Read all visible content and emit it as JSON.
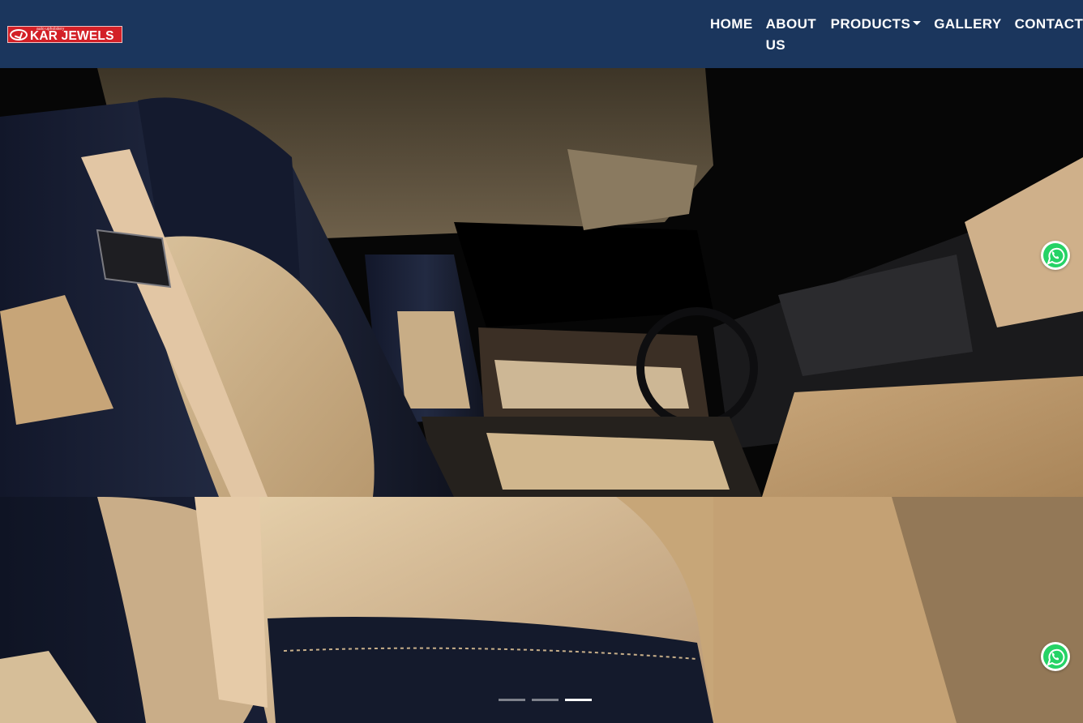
{
  "brand": {
    "name": "KAR JEWELS",
    "tagline": "auto upholstery",
    "colors": {
      "navbar": "#1b365d",
      "logo_bg": "#d32027",
      "whatsapp": "#25d366"
    }
  },
  "nav": {
    "items": [
      {
        "label": "HOME"
      },
      {
        "label": "ABOUT US"
      },
      {
        "label": "PRODUCTS",
        "dropdown": true
      },
      {
        "label": "GALLERY"
      },
      {
        "label": "CONTACT"
      }
    ]
  },
  "hero": {
    "image_subject": "car interior with black and beige leather seats",
    "slides": [
      {
        "active": false
      },
      {
        "active": false
      },
      {
        "active": true
      }
    ]
  },
  "floating": {
    "whatsapp_icon": "whatsapp-icon"
  }
}
